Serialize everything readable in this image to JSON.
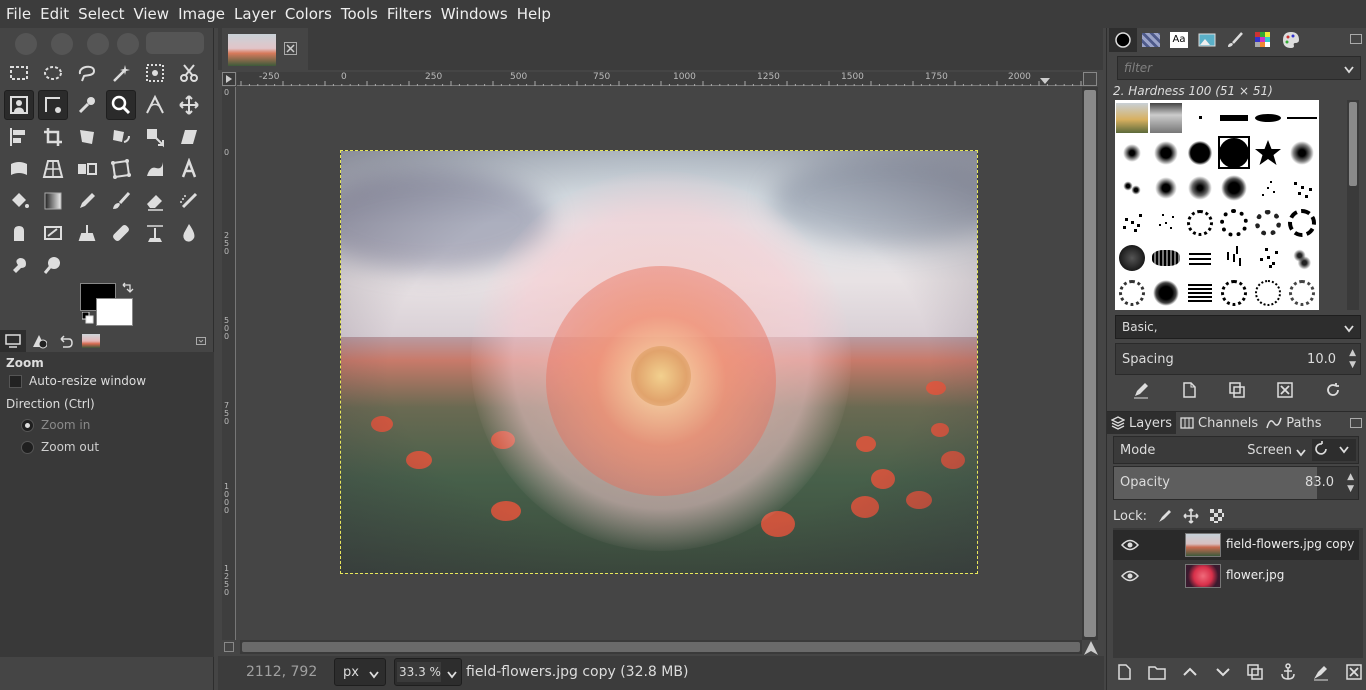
{
  "menubar": [
    "File",
    "Edit",
    "Select",
    "View",
    "Image",
    "Layer",
    "Colors",
    "Tools",
    "Filters",
    "Windows",
    "Help"
  ],
  "tool_options": {
    "title": "Zoom",
    "auto_resize_label": "Auto-resize window",
    "direction_label": "Direction  (Ctrl)",
    "zoom_in_label": "Zoom in",
    "zoom_out_label": "Zoom out"
  },
  "ruler": {
    "top_labels": [
      "-250",
      "0",
      "250",
      "500",
      "750",
      "1000",
      "1250",
      "1500",
      "1750",
      "2000"
    ],
    "left_labels": [
      "0",
      "0",
      "2\n5\n0",
      "5\n0\n0",
      "7\n5\n0",
      "1\n0\n0\n0",
      "1\n2\n5\n0"
    ]
  },
  "status": {
    "coords": "2112, 792",
    "unit": "px",
    "zoom": "33.3 %",
    "message": "field-flowers.jpg copy (32.8 MB)"
  },
  "brushes": {
    "filter_placeholder": "filter",
    "selected_name": "2. Hardness 100 (51 × 51)",
    "preset": "Basic,",
    "spacing_label": "Spacing",
    "spacing_value": "10.0"
  },
  "layers_panel": {
    "tabs": [
      "Layers",
      "Channels",
      "Paths"
    ],
    "mode_label": "Mode",
    "mode_value": "Screen",
    "opacity_label": "Opacity",
    "opacity_value": "83.0",
    "opacity_fraction": 0.83,
    "lock_label": "Lock:",
    "layers": [
      {
        "name": "field-flowers.jpg copy"
      },
      {
        "name": "flower.jpg"
      }
    ]
  }
}
